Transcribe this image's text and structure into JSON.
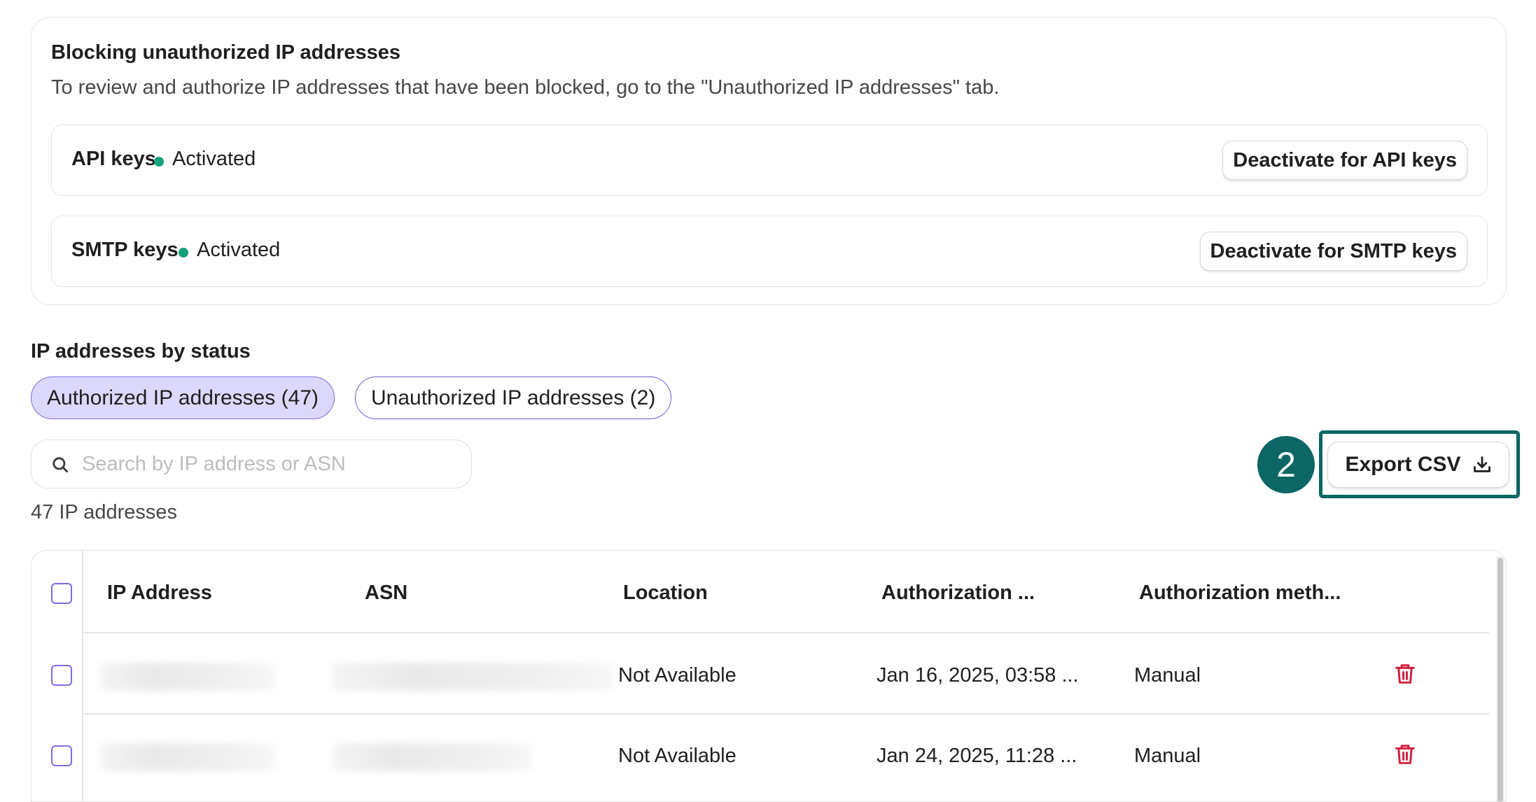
{
  "blocking": {
    "title": "Blocking unauthorized IP addresses",
    "description": "To review and authorize IP addresses that have been blocked, go to the \"Unauthorized IP addresses\" tab.",
    "rows": [
      {
        "name": "API keys",
        "status": "Activated",
        "button": "Deactivate for API keys"
      },
      {
        "name": "SMTP keys",
        "status": "Activated",
        "button": "Deactivate for SMTP keys"
      }
    ]
  },
  "status_section": {
    "title": "IP addresses by status",
    "tabs": [
      {
        "label": "Authorized IP addresses (47)",
        "active": true
      },
      {
        "label": "Unauthorized IP addresses (2)",
        "active": false
      }
    ]
  },
  "search": {
    "placeholder": "Search by IP address or ASN",
    "value": ""
  },
  "count_label": "47 IP addresses",
  "export": {
    "label": "Export CSV",
    "step_number": "2"
  },
  "table": {
    "columns": [
      "IP Address",
      "ASN",
      "Location",
      "Authorization ...",
      "Authorization meth..."
    ],
    "rows": [
      {
        "ip": "",
        "asn": "",
        "location": "Not Available",
        "date": "Jan 16, 2025, 03:58 ...",
        "method": "Manual"
      },
      {
        "ip": "",
        "asn": "",
        "location": "Not Available",
        "date": "Jan 24, 2025, 11:28 ...",
        "method": "Manual"
      }
    ]
  },
  "colors": {
    "accent": "#7c6ee0",
    "active_tab_bg": "#dcd8fb",
    "status_green": "#13a07a",
    "highlight_teal": "#0b6664",
    "delete_red": "#d0213f"
  },
  "icons": {
    "search": "search-icon",
    "export": "download-icon",
    "delete": "trash-icon"
  }
}
